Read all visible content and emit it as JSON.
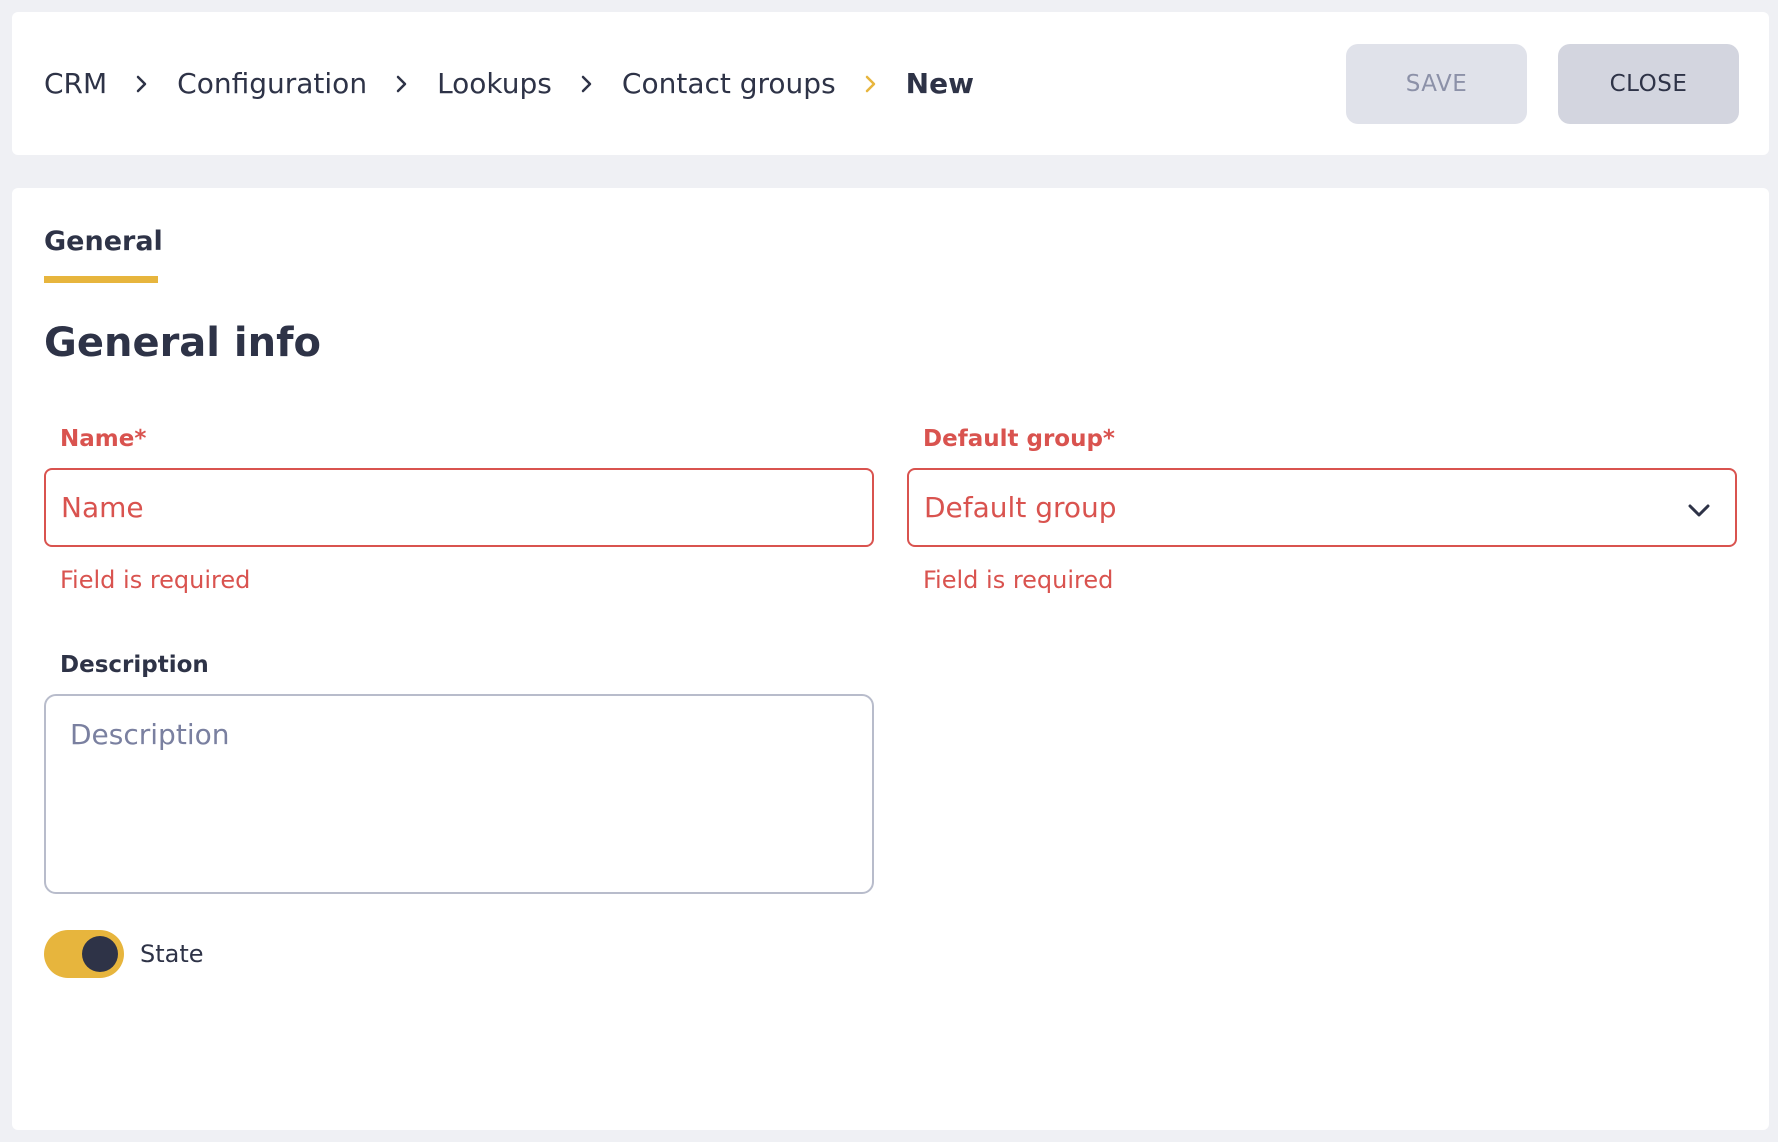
{
  "breadcrumb": {
    "items": [
      "CRM",
      "Configuration",
      "Lookups",
      "Contact groups"
    ],
    "current": "New"
  },
  "toolbar": {
    "save_label": "SAVE",
    "close_label": "CLOSE"
  },
  "tabs": [
    {
      "label": "General",
      "active": true
    }
  ],
  "section": {
    "title": "General info"
  },
  "form": {
    "name": {
      "label": "Name*",
      "placeholder": "Name",
      "value": "",
      "error": "Field is required"
    },
    "default_group": {
      "label": "Default group*",
      "placeholder": "Default group",
      "value": "",
      "error": "Field is required"
    },
    "description": {
      "label": "Description",
      "placeholder": "Description",
      "value": ""
    },
    "state": {
      "label": "State",
      "enabled": true
    }
  },
  "colors": {
    "accent": "#e7b53d",
    "error": "#d9534f",
    "text": "#2e3347",
    "background": "#eff0f4"
  },
  "icons": {
    "breadcrumb_separator": "chevron-right-icon",
    "select_arrow": "chevron-down-icon"
  }
}
